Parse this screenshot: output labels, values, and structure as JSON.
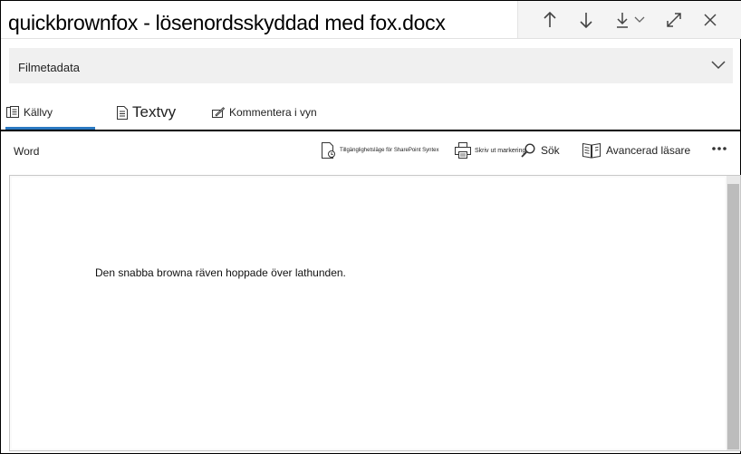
{
  "header": {
    "title": "quickbrownfox - lösenordsskyddad med fox.docx"
  },
  "nav": {
    "icons": [
      "arrow-up-icon",
      "arrow-down-icon",
      "download-icon",
      "chevron-down-icon",
      "expand-icon",
      "close-icon"
    ]
  },
  "metadata": {
    "label": "Filmetadata"
  },
  "tabs": [
    {
      "label": "Källvy",
      "icon": "source-view-icon",
      "active": true
    },
    {
      "label": "Textvy",
      "icon": "text-view-icon",
      "active": false
    },
    {
      "label": "Kommentera i vyn",
      "icon": "annotate-icon",
      "active": false
    }
  ],
  "toolbar": {
    "app_label": "Word",
    "accessibility_label": "Tillgänglighetsläge för SharePoint Syntex",
    "print_label": "Skriv ut markering",
    "search_label": "Sök",
    "reader_label": "Avancerad läsare"
  },
  "document": {
    "text": "Den snabba browna räven hoppade över lathunden."
  },
  "colors": {
    "accent": "#2b79c2",
    "metadata_bg": "#f0f0f0",
    "scrollbar_thumb": "#bcbcbc"
  }
}
